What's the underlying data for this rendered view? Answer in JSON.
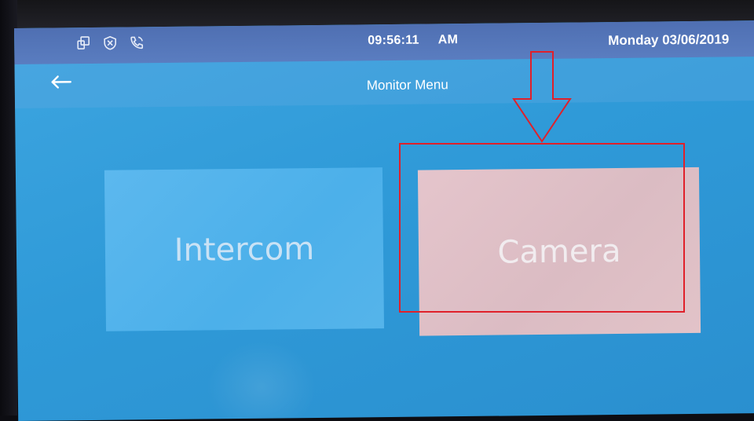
{
  "status_bar": {
    "icons": [
      "devices-icon",
      "shield-icon",
      "phone-icon"
    ],
    "time": "09:56:11",
    "meridiem": "AM",
    "date": "Monday 03/06/2019"
  },
  "header": {
    "back_icon": "back-arrow-icon",
    "title": "Monitor Menu"
  },
  "menu": {
    "tiles": [
      {
        "label": "Intercom"
      },
      {
        "label": "Camera",
        "highlighted": true
      }
    ]
  },
  "annotation": {
    "color": "#e0202a",
    "arrow": "down-arrow",
    "target": "Camera"
  },
  "colors": {
    "status_bar": "#5575b9",
    "screen": "#329dda",
    "intercom_tile": "#52b3ec",
    "camera_tile": "#e0c1c7"
  }
}
